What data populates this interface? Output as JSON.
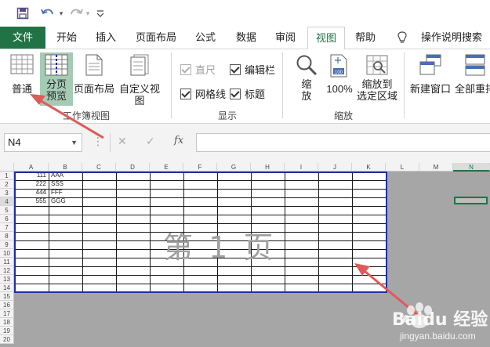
{
  "colors": {
    "file_tab": "#217346",
    "accent": "#217346",
    "page_border": "#1f2ea0",
    "annotation_arrow": "#e05a5a",
    "outside_print_area": "#a6a6a6"
  },
  "quick_access": {
    "save_icon": "save-icon",
    "undo_icon": "undo-icon",
    "redo_icon": "redo-icon",
    "customize_icon": "chevron-down-icon"
  },
  "tabs": [
    {
      "label": "文件",
      "kind": "file"
    },
    {
      "label": "开始"
    },
    {
      "label": "插入"
    },
    {
      "label": "页面布局"
    },
    {
      "label": "公式"
    },
    {
      "label": "数据"
    },
    {
      "label": "审阅"
    },
    {
      "label": "视图",
      "active": true
    },
    {
      "label": "帮助"
    }
  ],
  "tell_me": "操作说明搜索",
  "ribbon": {
    "workbook_views": {
      "normal": "普通",
      "page_break_preview_line1": "分页",
      "page_break_preview_line2": "预览",
      "page_layout": "页面布局",
      "custom_views": "自定义视图",
      "group_label": "工作簿视图"
    },
    "show": {
      "ruler": "直尺",
      "formula_bar": "编辑栏",
      "gridlines": "网格线",
      "headings": "标题",
      "group_label": "显示"
    },
    "zoom": {
      "zoom_line1": "缩",
      "zoom_line2": "放",
      "zoom_100": "100%",
      "zoom_selection_line1": "缩放到",
      "zoom_selection_line2": "选定区域",
      "group_label": "缩放"
    },
    "window": {
      "new_window": "新建窗口",
      "arrange_all": "全部重排"
    }
  },
  "formula_bar": {
    "name_box": "N4",
    "cancel": "✕",
    "enter": "✓",
    "fx": "fx",
    "value": ""
  },
  "columns": [
    "A",
    "B",
    "C",
    "D",
    "E",
    "F",
    "G",
    "H",
    "I",
    "J",
    "K",
    "L",
    "M",
    "N"
  ],
  "rows": [
    "1",
    "2",
    "3",
    "4",
    "5",
    "6",
    "7",
    "8",
    "9",
    "10",
    "11",
    "12",
    "13",
    "14",
    "15",
    "16",
    "17",
    "18",
    "19",
    "20"
  ],
  "cells": [
    {
      "a": "111",
      "b": "AAA"
    },
    {
      "a": "222",
      "b": "SSS"
    },
    {
      "a": "444",
      "b": "FFF"
    },
    {
      "a": "555",
      "b": "GGG"
    }
  ],
  "page_label": "第 1 页",
  "watermark": {
    "brand": "Baidu 经验",
    "url": "jingyan.baidu.com"
  }
}
